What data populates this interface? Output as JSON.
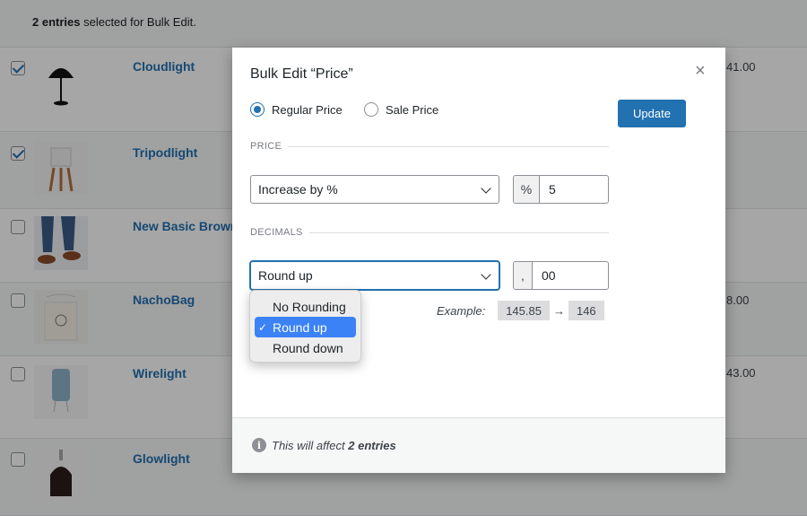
{
  "bulk_bar": {
    "count": "2 entries",
    "suffix": " selected for Bulk Edit."
  },
  "rows": [
    {
      "name": "Cloudlight",
      "price": "41.00",
      "checked": true
    },
    {
      "name": "Tripodlight",
      "price": "",
      "checked": true
    },
    {
      "name": "New Basic Brown",
      "price": "",
      "checked": false
    },
    {
      "name": "NachoBag",
      "price": "8.00",
      "checked": false
    },
    {
      "name": "Wirelight",
      "price": "43.00",
      "checked": false
    },
    {
      "name": "Glowlight",
      "price": "",
      "checked": false
    }
  ],
  "modal": {
    "title": "Bulk Edit “Price”",
    "close_icon": "×",
    "radio_regular": "Regular Price",
    "radio_sale": "Sale Price",
    "update_label": "Update",
    "price_section": "PRICE",
    "price_select": "Increase by %",
    "price_prefix": "%",
    "price_value": "5",
    "decimals_section": "DECIMALS",
    "decimals_select": "Round up",
    "decimals_prefix": ",",
    "decimals_value": "00",
    "example_label": "Example:",
    "example_from": "145.85",
    "example_arrow": "→",
    "example_to": "146",
    "footer_icon": "i",
    "footer_prefix": "This will affect ",
    "footer_count": "2 entries"
  },
  "menu": {
    "items": [
      "No Rounding",
      "Round up",
      "Round down"
    ],
    "selected_check": "✓"
  },
  "colors": {
    "accent": "#2271b1",
    "menu_selected": "#3b82f6"
  }
}
